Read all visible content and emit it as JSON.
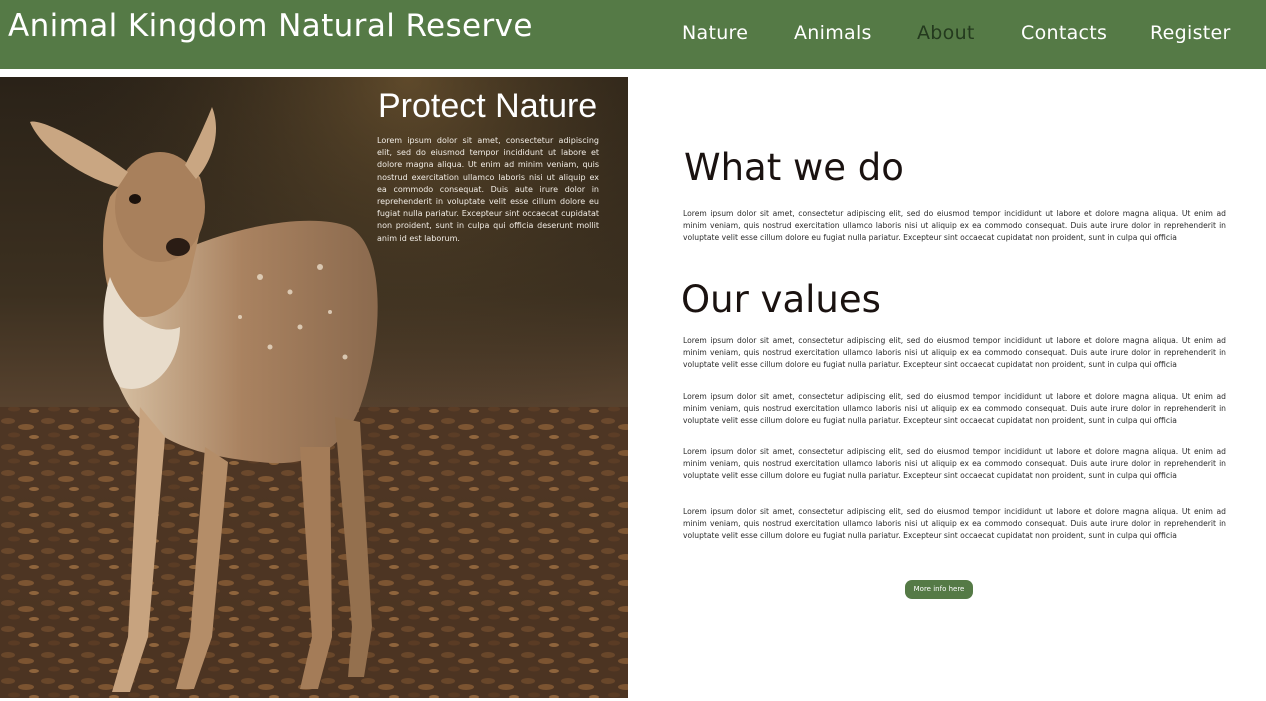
{
  "header": {
    "title": "Animal Kingdom Natural Reserve",
    "nav": [
      {
        "label": "Nature",
        "active": false
      },
      {
        "label": "Animals",
        "active": false
      },
      {
        "label": "About",
        "active": true
      },
      {
        "label": "Contacts",
        "active": false
      },
      {
        "label": "Register",
        "active": false
      }
    ]
  },
  "hero": {
    "image": "fawn-deer-photo",
    "title": "Protect Nature",
    "text": "Lorem ipsum dolor sit amet, consectetur adipiscing elit, sed do eiusmod tempor incididunt ut labore et dolore magna aliqua. Ut enim ad minim veniam, quis nostrud exercitation ullamco laboris nisi ut aliquip ex ea commodo consequat. Duis aute irure dolor in reprehenderit in voluptate velit esse cillum dolore eu fugiat nulla pariatur. Excepteur sint occaecat cupidatat non proident, sunt in culpa qui officia deserunt mollit anim id est laborum."
  },
  "what_we_do": {
    "heading": "What we do",
    "text": "Lorem ipsum dolor sit amet, consectetur adipiscing elit, sed do eiusmod tempor incididunt ut labore et dolore magna aliqua. Ut enim ad minim veniam, quis nostrud exercitation ullamco laboris nisi ut aliquip ex ea commodo consequat. Duis aute irure dolor in reprehenderit in voluptate velit esse cillum dolore eu fugiat nulla pariatur. Excepteur sint occaecat cupidatat non proident, sunt in culpa qui officia"
  },
  "our_values": {
    "heading": "Our values",
    "paragraphs": [
      "Lorem ipsum dolor sit amet, consectetur adipiscing elit, sed do eiusmod tempor incididunt ut labore et dolore magna aliqua. Ut enim ad minim veniam, quis nostrud exercitation ullamco laboris nisi ut aliquip ex ea commodo consequat. Duis aute irure dolor in reprehenderit in voluptate velit esse cillum dolore eu fugiat nulla pariatur. Excepteur sint occaecat cupidatat non proident, sunt in culpa qui officia",
      "Lorem ipsum dolor sit amet, consectetur adipiscing elit, sed do eiusmod tempor incididunt ut labore et dolore magna aliqua. Ut enim ad minim veniam, quis nostrud exercitation ullamco laboris nisi ut aliquip ex ea commodo consequat. Duis aute irure dolor in reprehenderit in voluptate velit esse cillum dolore eu fugiat nulla pariatur. Excepteur sint occaecat cupidatat non proident, sunt in culpa qui officia",
      "Lorem ipsum dolor sit amet, consectetur adipiscing elit, sed do eiusmod tempor incididunt ut labore et dolore magna aliqua. Ut enim ad minim veniam, quis nostrud exercitation ullamco laboris nisi ut aliquip ex ea commodo consequat. Duis aute irure dolor in reprehenderit in voluptate velit esse cillum dolore eu fugiat nulla pariatur. Excepteur sint occaecat cupidatat non proident, sunt in culpa qui officia",
      "Lorem ipsum dolor sit amet, consectetur adipiscing elit, sed do eiusmod tempor incididunt ut labore et dolore magna aliqua. Ut enim ad minim veniam, quis nostrud exercitation ullamco laboris nisi ut aliquip ex ea commodo consequat. Duis aute irure dolor in reprehenderit in voluptate velit esse cillum dolore eu fugiat nulla pariatur. Excepteur sint occaecat cupidatat non proident, sunt in culpa qui officia"
    ]
  },
  "button": {
    "label": "More info here"
  },
  "colors": {
    "brand_green": "#557a46",
    "active_nav": "#243a1e",
    "heading": "#1a1210",
    "body_text": "#2b2b2b"
  }
}
